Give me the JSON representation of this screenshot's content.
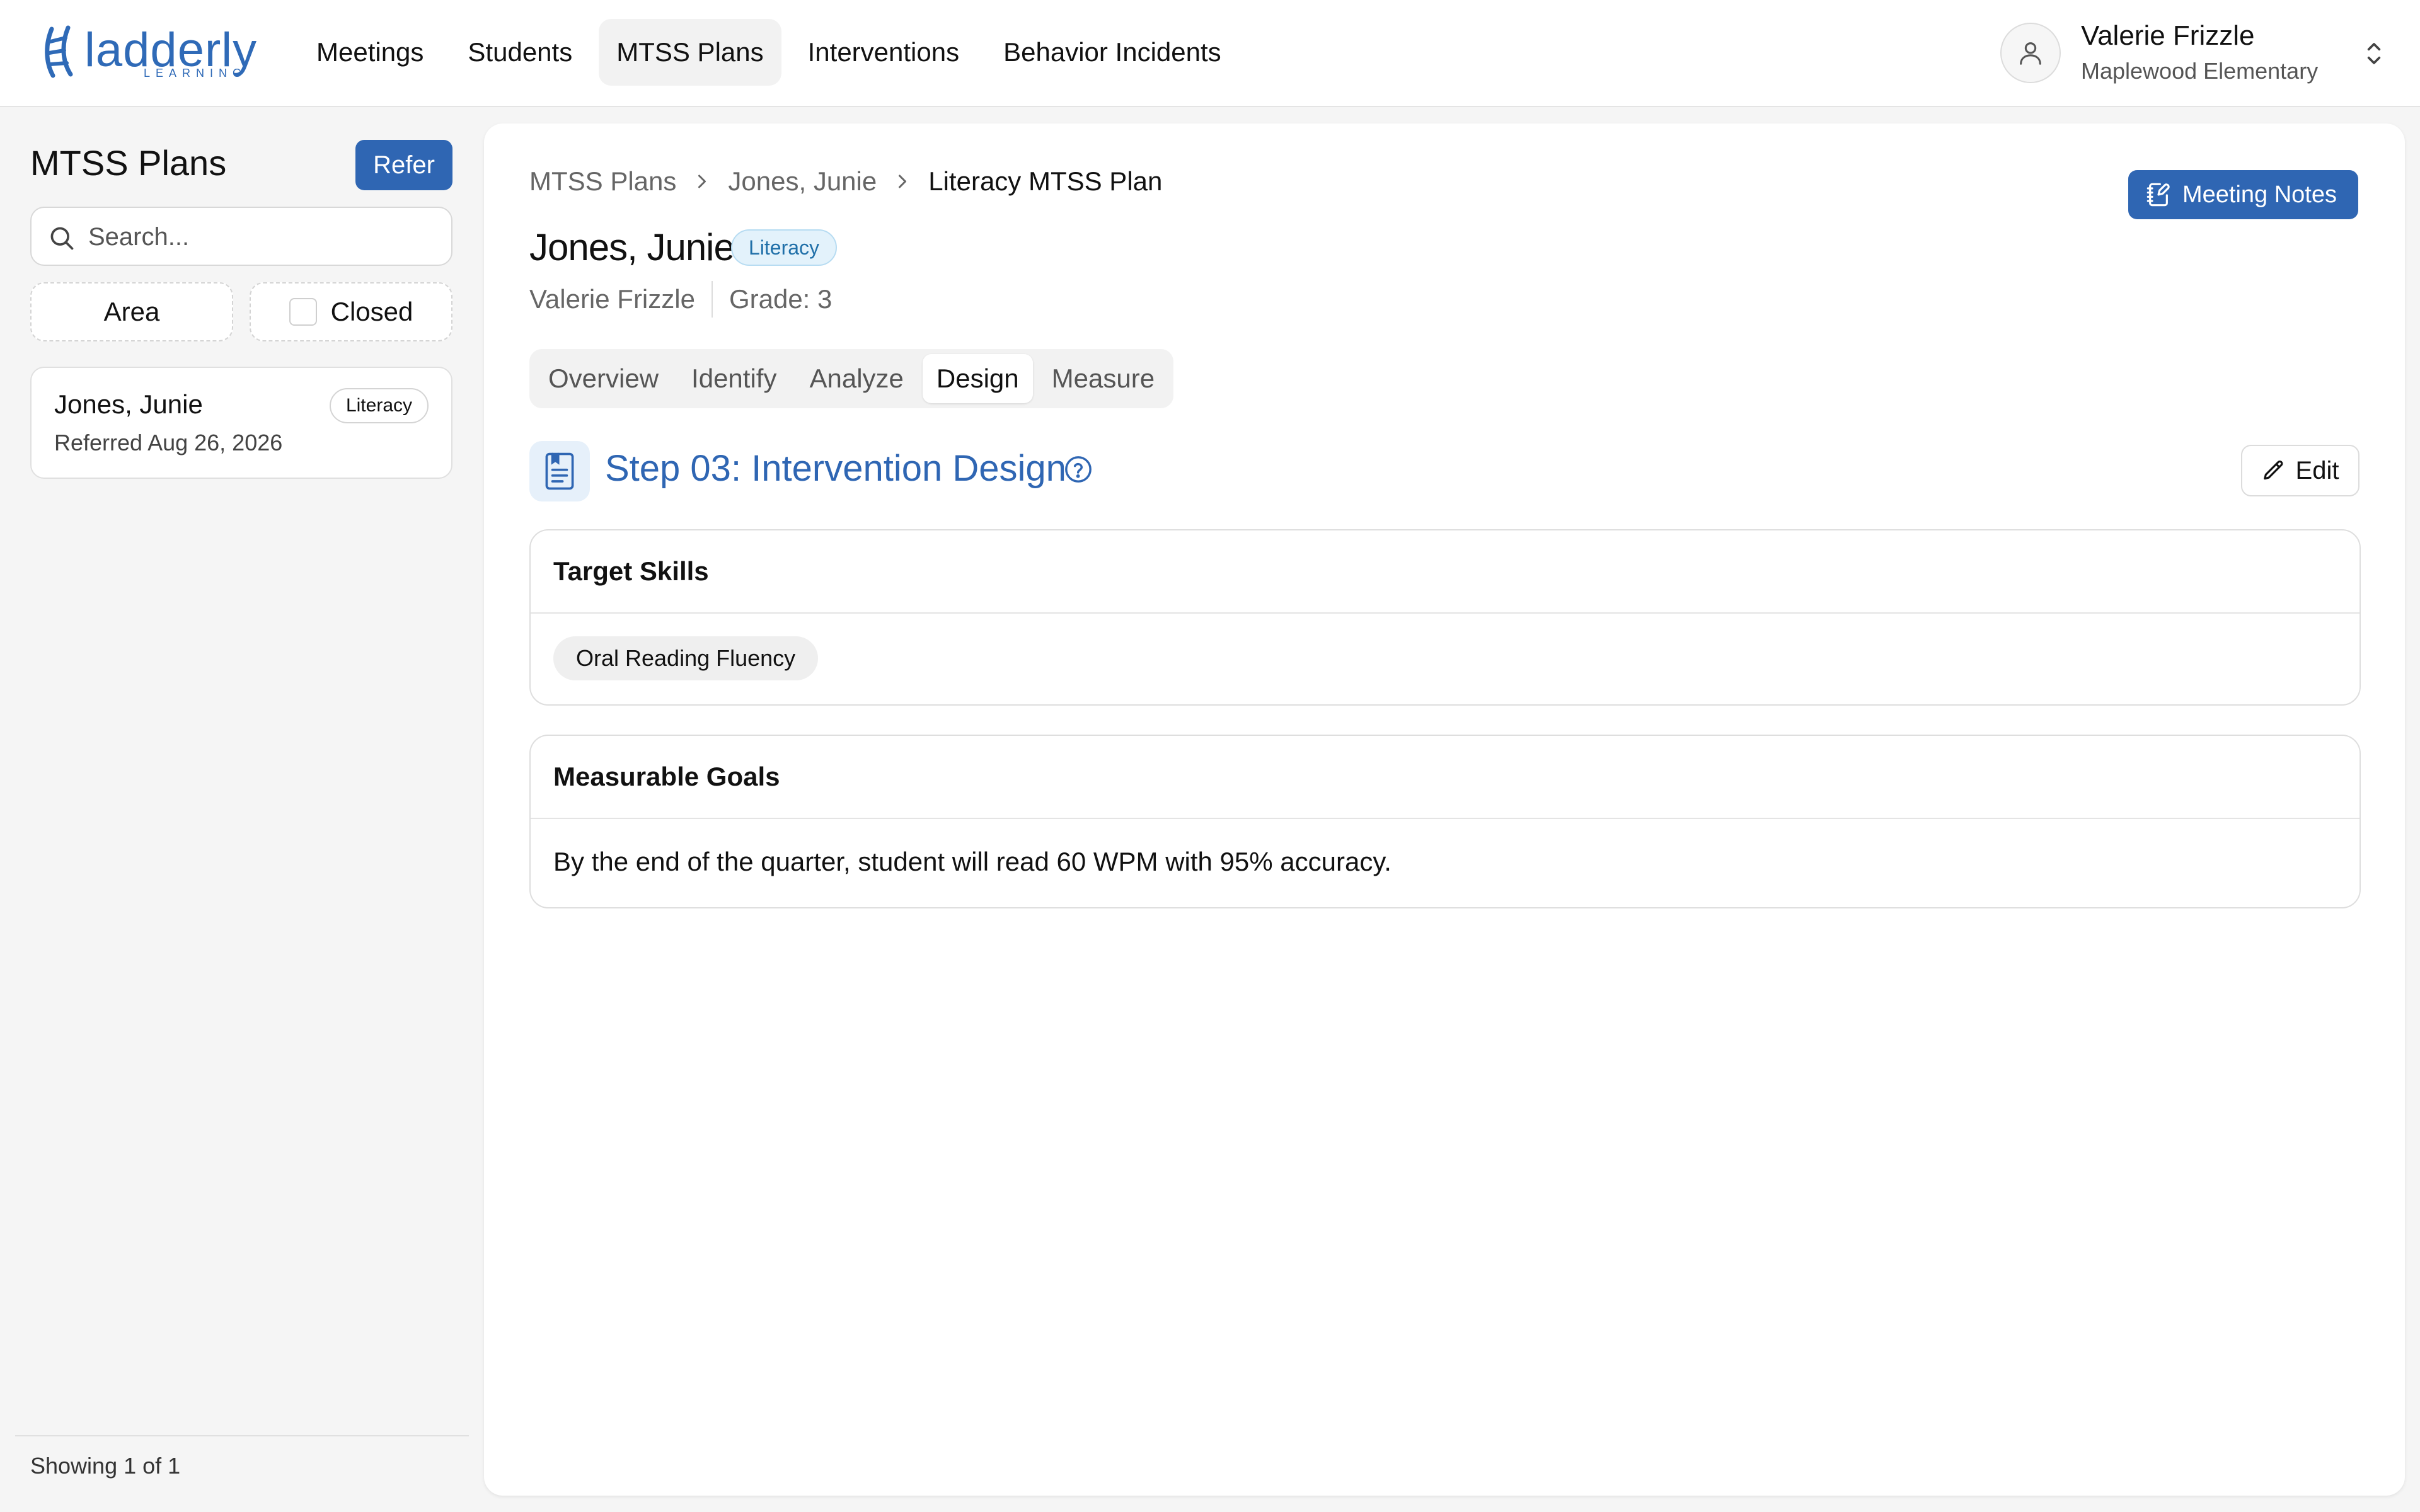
{
  "app": {
    "brand": "ladderly",
    "brand_sub": "LEARNING",
    "accent_color": "#2f66b3"
  },
  "nav": {
    "items": [
      {
        "label": "Meetings"
      },
      {
        "label": "Students"
      },
      {
        "label": "MTSS Plans"
      },
      {
        "label": "Interventions"
      },
      {
        "label": "Behavior Incidents"
      }
    ]
  },
  "user": {
    "name": "Valerie Frizzle",
    "school": "Maplewood Elementary"
  },
  "sidebar": {
    "title": "MTSS Plans",
    "refer_label": "Refer",
    "search_placeholder": "Search...",
    "filter_area": "Area",
    "filter_closed": "Closed",
    "plans": [
      {
        "name": "Jones, Junie",
        "badge": "Literacy",
        "date": "Referred Aug 26, 2026"
      }
    ],
    "footer": "Showing 1 of 1"
  },
  "main": {
    "breadcrumb": [
      "MTSS Plans",
      "Jones, Junie",
      "Literacy MTSS Plan"
    ],
    "meeting_notes_label": "Meeting Notes",
    "student_name": "Jones, Junie",
    "area_badge": "Literacy",
    "teacher": "Valerie Frizzle",
    "grade": "Grade: 3",
    "tabs": [
      "Overview",
      "Identify",
      "Analyze",
      "Design",
      "Measure"
    ],
    "active_tab": "Design",
    "step_title": "Step 03: Intervention Design",
    "edit_label": "Edit",
    "target_skills": {
      "heading": "Target Skills",
      "chips": [
        "Oral Reading Fluency"
      ]
    },
    "measurable_goals": {
      "heading": "Measurable Goals",
      "text": "By the end of the quarter, student will read 60 WPM with 95% accuracy."
    }
  }
}
